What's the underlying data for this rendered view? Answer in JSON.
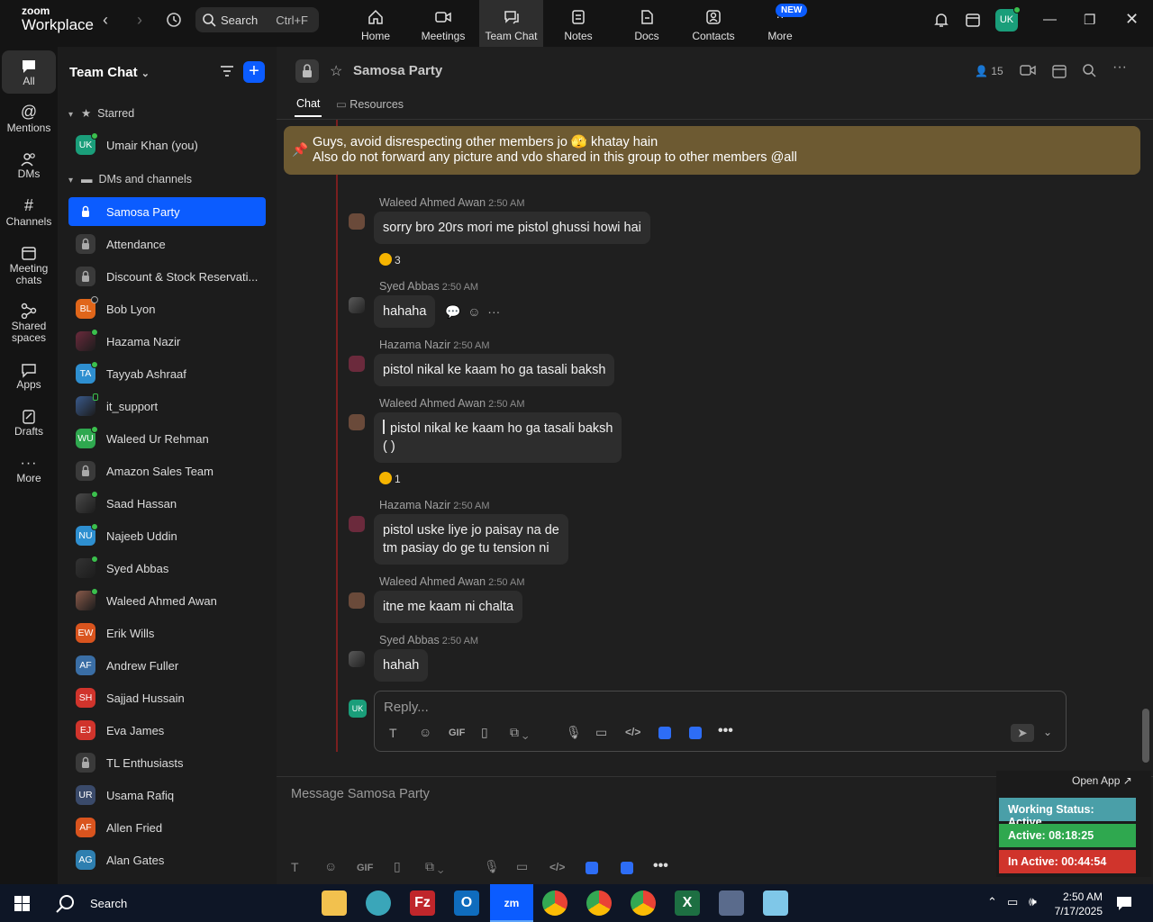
{
  "app": {
    "logo_top": "zoom",
    "logo_bottom": "Workplace"
  },
  "search": {
    "label": "Search",
    "shortcut": "Ctrl+F"
  },
  "top_nav": [
    {
      "label": "Home",
      "icon": "home-icon"
    },
    {
      "label": "Meetings",
      "icon": "video-icon"
    },
    {
      "label": "Team Chat",
      "icon": "chat-icon",
      "active": true
    },
    {
      "label": "Notes",
      "icon": "notes-icon"
    },
    {
      "label": "Docs",
      "icon": "docs-icon"
    },
    {
      "label": "Contacts",
      "icon": "contacts-icon"
    },
    {
      "label": "More",
      "icon": "more-icon",
      "badge": "NEW"
    }
  ],
  "user_initials": "UK",
  "rail": [
    {
      "label": "All",
      "icon": "chat-bubble-icon",
      "active": true
    },
    {
      "label": "Mentions",
      "icon": "at-icon"
    },
    {
      "label": "DMs",
      "icon": "people-icon"
    },
    {
      "label": "Channels",
      "icon": "hash-icon"
    },
    {
      "label": "Meeting chats",
      "icon": "calendar-icon"
    },
    {
      "label": "Shared spaces",
      "icon": "share-icon"
    },
    {
      "label": "Apps",
      "icon": "apps-icon"
    },
    {
      "label": "Drafts",
      "icon": "drafts-icon"
    },
    {
      "label": "More",
      "icon": "ellipsis-icon"
    }
  ],
  "sidebar": {
    "title": "Team Chat",
    "starred_label": "Starred",
    "dms_label": "DMs and channels",
    "starred": [
      {
        "name": "Umair Khan (you)",
        "initials": "UK",
        "color": "#1a9e7a",
        "status": "online"
      }
    ],
    "items": [
      {
        "name": "Samosa Party",
        "type": "lock",
        "active": true
      },
      {
        "name": "Attendance",
        "type": "lock"
      },
      {
        "name": "Discount & Stock Reservati...",
        "type": "lock"
      },
      {
        "name": "Bob Lyon",
        "initials": "BL",
        "color": "#e0661a",
        "status": "away"
      },
      {
        "name": "Hazama Nazir",
        "type": "photo",
        "color": "#6b2a3c",
        "status": "online"
      },
      {
        "name": "Tayyab Ashraaf",
        "initials": "TA",
        "color": "#2e8fd0",
        "status": "online"
      },
      {
        "name": "it_support",
        "type": "photo",
        "color": "#3a5a8c",
        "status": "mobile"
      },
      {
        "name": "Waleed Ur Rehman",
        "initials": "WU",
        "color": "#2fa84f",
        "status": "online"
      },
      {
        "name": "Amazon Sales Team",
        "type": "lock"
      },
      {
        "name": "Saad Hassan",
        "type": "photo",
        "color": "#4a4a4a",
        "status": "online"
      },
      {
        "name": "Najeeb Uddin",
        "initials": "NU",
        "color": "#2e8fd0",
        "status": "online"
      },
      {
        "name": "Syed Abbas",
        "type": "photo",
        "color": "#333333",
        "status": "online"
      },
      {
        "name": "Waleed Ahmed Awan",
        "type": "photo",
        "color": "#8a5a4a",
        "status": "online"
      },
      {
        "name": "Erik Wills",
        "initials": "EW",
        "color": "#d9541e"
      },
      {
        "name": "Andrew Fuller",
        "initials": "AF",
        "color": "#3a6ea5"
      },
      {
        "name": "Sajjad Hussain",
        "initials": "SH",
        "color": "#d0342c"
      },
      {
        "name": "Eva James",
        "initials": "EJ",
        "color": "#d0342c"
      },
      {
        "name": "TL Enthusiasts",
        "type": "lock"
      },
      {
        "name": "Usama Rafiq",
        "initials": "UR",
        "color": "#3a4a6a"
      },
      {
        "name": "Allen Fried",
        "initials": "AF",
        "color": "#d9541e"
      },
      {
        "name": "Alan Gates",
        "initials": "AG",
        "color": "#2e7fb0"
      }
    ]
  },
  "channel": {
    "title": "Samosa Party",
    "members": "15",
    "tabs": [
      "Chat",
      "Resources"
    ],
    "pinned_line1": "Guys, avoid disrespecting other members jo 🫣 khatay hain",
    "pinned_line2": "Also do not forward any picture and vdo shared in this group to other members @all"
  },
  "messages": [
    {
      "sender": "Waleed Ahmed Awan",
      "time": "2:50 AM",
      "text": "sorry bro 20rs mori me pistol ghussi howi hai",
      "reaction_count": "3"
    },
    {
      "sender": "Syed Abbas",
      "time": "2:50 AM",
      "text": "hahaha"
    },
    {
      "sender": "Hazama Nazir",
      "time": "2:50 AM",
      "text": "pistol nikal ke kaam ho ga tasali baksh"
    },
    {
      "sender": "Waleed Ahmed Awan",
      "time": "2:50 AM",
      "quote": "pistol nikal ke kaam ho ga tasali baksh",
      "text": "(                )",
      "reaction_count": "1"
    },
    {
      "sender": "Hazama Nazir",
      "time": "2:50 AM",
      "text": "pistol uske liye jo paisay na de",
      "text2": "tm pasiay do ge tu tension ni"
    },
    {
      "sender": "Waleed Ahmed Awan",
      "time": "2:50 AM",
      "text": "itne me kaam ni chalta"
    },
    {
      "sender": "Syed Abbas",
      "time": "2:50 AM",
      "text": "hahah"
    }
  ],
  "reply": {
    "placeholder": "Reply...",
    "initials": "UK"
  },
  "compose": {
    "placeholder": "Message Samosa Party"
  },
  "toolbar": {
    "gif": "GIF"
  },
  "widget": {
    "open_app": "Open App ↗",
    "working": "Working Status: Active",
    "active": "Active: 08:18:25",
    "inactive": "In Active: 00:44:54",
    "colors": {
      "working": "#4a9fa8",
      "active": "#2fa84f",
      "inactive": "#d0342c"
    }
  },
  "taskbar": {
    "search": "Search",
    "time": "2:50 AM",
    "date": "7/17/2025"
  }
}
